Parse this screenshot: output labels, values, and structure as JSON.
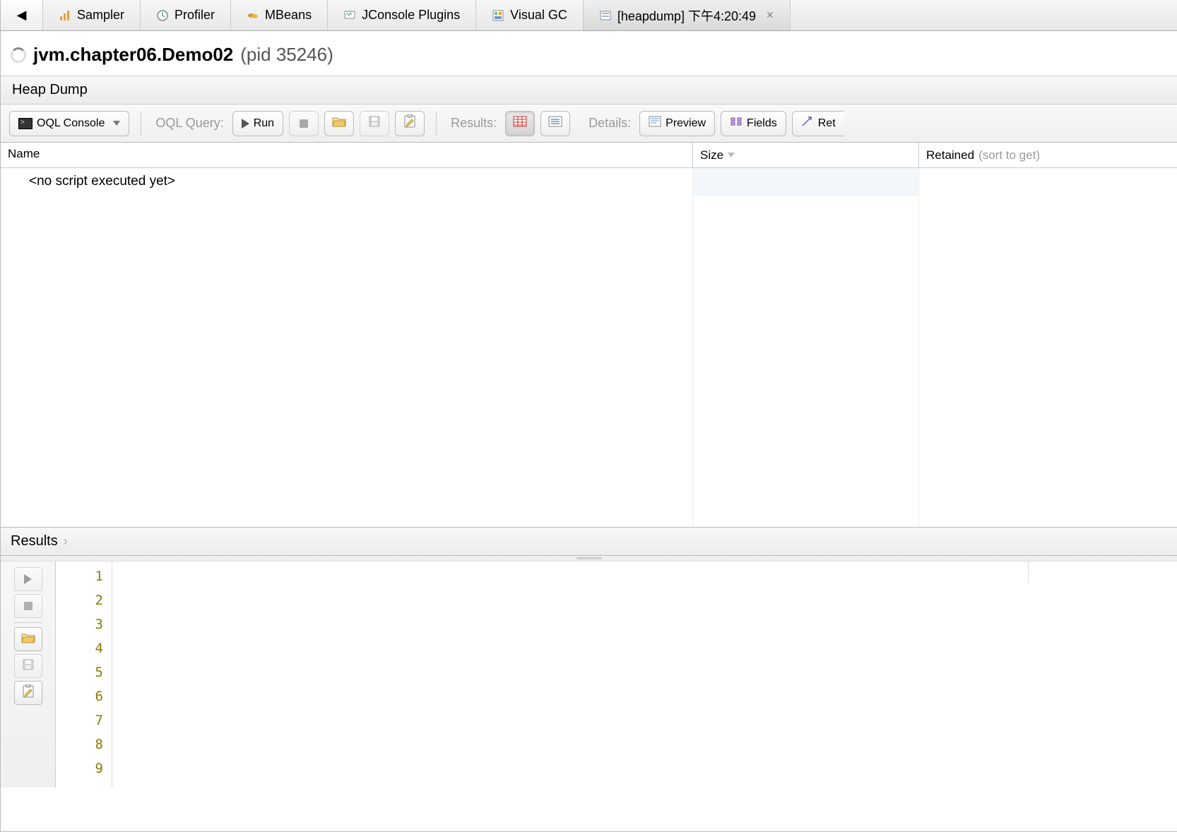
{
  "tabs": [
    {
      "label": "Sampler"
    },
    {
      "label": "Profiler"
    },
    {
      "label": "MBeans"
    },
    {
      "label": "JConsole Plugins"
    },
    {
      "label": "Visual GC"
    },
    {
      "label": "[heapdump] 下午4:20:49",
      "active": true,
      "closable": true
    }
  ],
  "header": {
    "title": "jvm.chapter06.Demo02",
    "pid_label": "(pid 35246)"
  },
  "subheader": "Heap Dump",
  "toolbar": {
    "console_label": "OQL Console",
    "query_label": "OQL Query:",
    "run_label": "Run",
    "results_label": "Results:",
    "details_label": "Details:",
    "preview_label": "Preview",
    "fields_label": "Fields",
    "references_label": "Ret"
  },
  "columns": {
    "name": "Name",
    "size": "Size",
    "retained": "Retained",
    "retained_hint": "(sort to get)"
  },
  "content": {
    "empty_message": "<no script executed yet>"
  },
  "results_section": {
    "title": "Results"
  },
  "editor": {
    "lines": [
      "1",
      "2",
      "3",
      "4",
      "5",
      "6",
      "7",
      "8",
      "9"
    ]
  }
}
